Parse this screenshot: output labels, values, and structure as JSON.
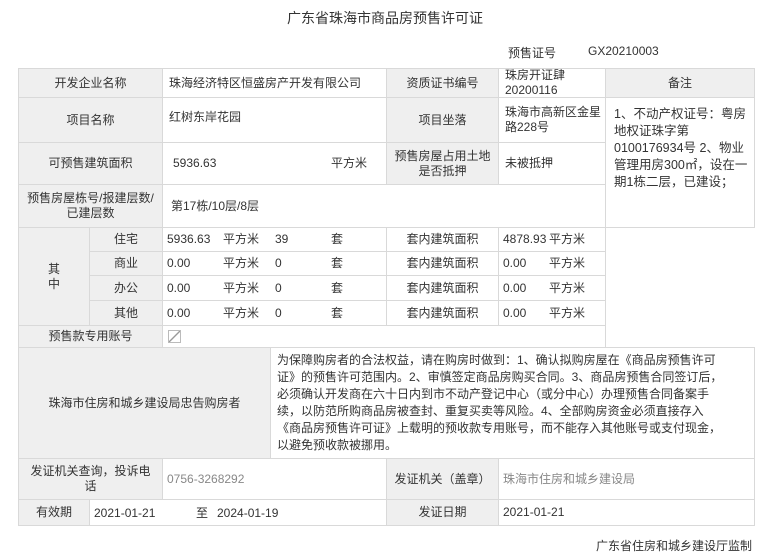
{
  "title": "广东省珠海市商品房预售许可证",
  "cert": {
    "label": "预售证号",
    "value": "GX20210003"
  },
  "row1": {
    "developer_label": "开发企业名称",
    "developer": "珠海经济特区恒盛房产开发有限公司",
    "qual_label": "资质证书编号",
    "qual_line1": "珠房开证肆",
    "qual_line2": "20200116",
    "remark_label": "备注"
  },
  "row2": {
    "project_label": "项目名称",
    "project": "红树东岸花园",
    "location_label": "项目坐落",
    "location_line1": "珠海市高新区金星",
    "location_line2": "路228号"
  },
  "remark_text": [
    "1、不动产权证号：粤房",
    "地权证珠字第",
    "0100176934号 2、物业",
    "管理用房300㎡，设在一",
    "期1栋二层，已建设；"
  ],
  "row3": {
    "area_label": "可预售建筑面积",
    "area": "5936.63",
    "unit": "平方米",
    "mortgage_label_line1": "预售房屋占用土地",
    "mortgage_label_line2": "是否抵押",
    "mortgage": "未被抵押"
  },
  "row4": {
    "building_label_line1": "预售房屋栋号/报建层数/",
    "building_label_line2": "已建层数",
    "building": "第17栋/10层/8层"
  },
  "breakdown": {
    "group_label_1": "其",
    "group_label_2": "中",
    "rows": [
      {
        "type": "住宅",
        "area": "5936.63",
        "unit": "平方米",
        "count": "39",
        "count_unit": "套",
        "inner_label": "套内建筑面积",
        "inner_area": "4878.93",
        "inner_unit": "平方米"
      },
      {
        "type": "商业",
        "area": "0.00",
        "unit": "平方米",
        "count": "0",
        "count_unit": "套",
        "inner_label": "套内建筑面积",
        "inner_area": "0.00",
        "inner_unit": "平方米"
      },
      {
        "type": "办公",
        "area": "0.00",
        "unit": "平方米",
        "count": "0",
        "count_unit": "套",
        "inner_label": "套内建筑面积",
        "inner_area": "0.00",
        "inner_unit": "平方米"
      },
      {
        "type": "其他",
        "area": "0.00",
        "unit": "平方米",
        "count": "0",
        "count_unit": "套",
        "inner_label": "套内建筑面积",
        "inner_area": "0.00",
        "inner_unit": "平方米"
      }
    ]
  },
  "account_label": "预售款专用账号",
  "notice": {
    "label": "珠海市住房和城乡建设局忠告购房者",
    "lines": [
      "为保障购房者的合法权益，请在购房时做到：1、确认拟购房屋在《商品房预售许可",
      "证》的预售许可范围内。2、审慎签定商品房购买合同。3、商品房预售合同签订后，",
      "必须确认开发商在六十日内到市不动产登记中心（或分中心）办理预售合同备案手",
      "续，以防范所购商品房被查封、重复买卖等风险。4、全部购房资金必须直接存入",
      "《商品房预售许可证》上载明的预收款专用账号，而不能存入其他账号或支付现金，",
      "以避免预收款被挪用。"
    ]
  },
  "issuer": {
    "query_label_line1": "发证机关查询，投诉电",
    "query_label_line2": "话",
    "phone": "0756-3268292",
    "label": "发证机关（盖章）",
    "name": "珠海市住房和城乡建设局"
  },
  "validity": {
    "label": "有效期",
    "from": "2021-01-21",
    "to_word": "至",
    "to": "2024-01-19",
    "issue_label": "发证日期",
    "issue_date": "2021-01-21"
  },
  "footer": "广东省住房和城乡建设厅监制"
}
